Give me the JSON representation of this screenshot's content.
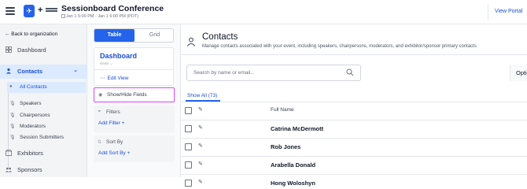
{
  "header": {
    "conference_title": "Sessionboard Conference",
    "dates": "Jan 1 5:00 PM - Jan 1 6:00 PM (PDT)",
    "plus": "+",
    "view_portal": "View Portal"
  },
  "nav": {
    "back": "← Back to organization",
    "dashboard": "Dashboard",
    "contacts": "Contacts",
    "all_contacts": "All Contacts",
    "sub_items": [
      "Speakers",
      "Chairpersons",
      "Moderators",
      "Session Submitters"
    ],
    "exhibitors": "Exhibitors",
    "sponsors": "Sponsors"
  },
  "panel": {
    "table_label": "Table",
    "grid_label": "Grid",
    "view_name": "Dashboard",
    "view_sub": "views ⌄",
    "edit_view": "Edit View",
    "show_hide": "Show/Hide Fields",
    "filters": "Filters",
    "add_filter": "Add Filter +",
    "sort_by": "Sort By",
    "add_sort": "Add Sort By +"
  },
  "main": {
    "title": "Contacts",
    "description": "Manage contacts associated with your event, including speakers, chairpersons, moderators, and exhibitor/sponsor primary contacts",
    "search_placeholder": "Search by name or email...",
    "options_label": "Opti",
    "tab_show_all": "Show All (73)",
    "column_full_name": "Full Name",
    "rows": [
      "Catrina McDermott",
      "Rob Jones",
      "Arabella Donald",
      "Hong Woloshyn"
    ]
  },
  "colors": {
    "accent": "#2563eb",
    "highlight": "#d946ef",
    "active_bg": "#dbeafe"
  }
}
